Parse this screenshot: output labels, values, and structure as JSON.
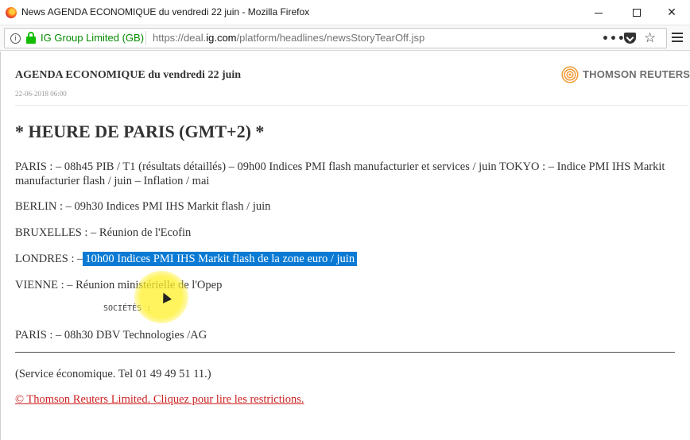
{
  "window": {
    "title": "News AGENDA ECONOMIQUE du vendredi 22 juin - Mozilla Firefox",
    "minimize": "",
    "maximize": "",
    "close": "✕"
  },
  "urlbar": {
    "identity": "IG Group Limited (GB)",
    "url_prefix": "https://deal.",
    "url_host": "ig.com",
    "url_path": "/platform/headlines/newsStoryTearOff.jsp",
    "more_glyph": "•••",
    "star_glyph": "☆",
    "info_glyph": "i"
  },
  "article": {
    "headline": "AGENDA ECONOMIQUE du vendredi 22 juin",
    "date": "22-06-2018 06:00",
    "logo_text": "THOMSON REUTERS",
    "heading": "* HEURE DE PARIS (GMT+2) *",
    "paragraphs": {
      "paris": "PARIS : – 08h45 PIB / T1 (résultats détaillés) – 09h00 Indices PMI flash manufacturier et services / juin TOKYO : – Indice PMI IHS Markit manufacturier flash / juin – Inflation / mai",
      "berlin": "BERLIN : – 09h30 Indices PMI IHS Markit flash / juin",
      "bruxelles": "BRUXELLES : – Réunion de l'Ecofin",
      "londres_prefix": "LONDRES : –",
      "londres_selected": "10h00 Indices PMI IHS Markit flash de la zone euro / juin",
      "vienne": "VIENNE : – Réunion ministérielle de l'Opep",
      "societes": "SOCIÉTÉS :",
      "paris_societes": "PARIS : – 08h30 DBV Technologies /AG",
      "service": "(Service économique. Tel 01 49 49 51 11.)"
    },
    "copyright": "© Thomson Reuters Limited. Cliquez pour lire les restrictions."
  },
  "colors": {
    "selection": "#0a7ad4",
    "link": "#cc2222",
    "secure_green": "#12bc00",
    "cursor_highlight": "#fff028"
  }
}
